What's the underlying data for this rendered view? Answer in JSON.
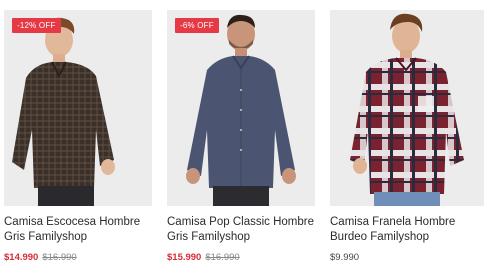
{
  "products": [
    {
      "discount_badge": "-12% OFF",
      "name": "Camisa Escocesa Hombre Gris Familyshop",
      "sale_price": "$14.990",
      "original_price": "$16.990",
      "shirt_color": "#3b2f2a"
    },
    {
      "discount_badge": "-6% OFF",
      "name": "Camisa Pop Classic Hombre Gris Familyshop",
      "sale_price": "$15.990",
      "original_price": "$16.990",
      "shirt_color": "#4b5470"
    },
    {
      "name": "Camisa Franela Hombre Burdeo Familyshop",
      "price": "$9.990",
      "shirt_color": "#7a2230"
    }
  ],
  "colors": {
    "badge": "#e63946",
    "sale_price": "#d62c38",
    "image_background": "#eeeeee"
  }
}
